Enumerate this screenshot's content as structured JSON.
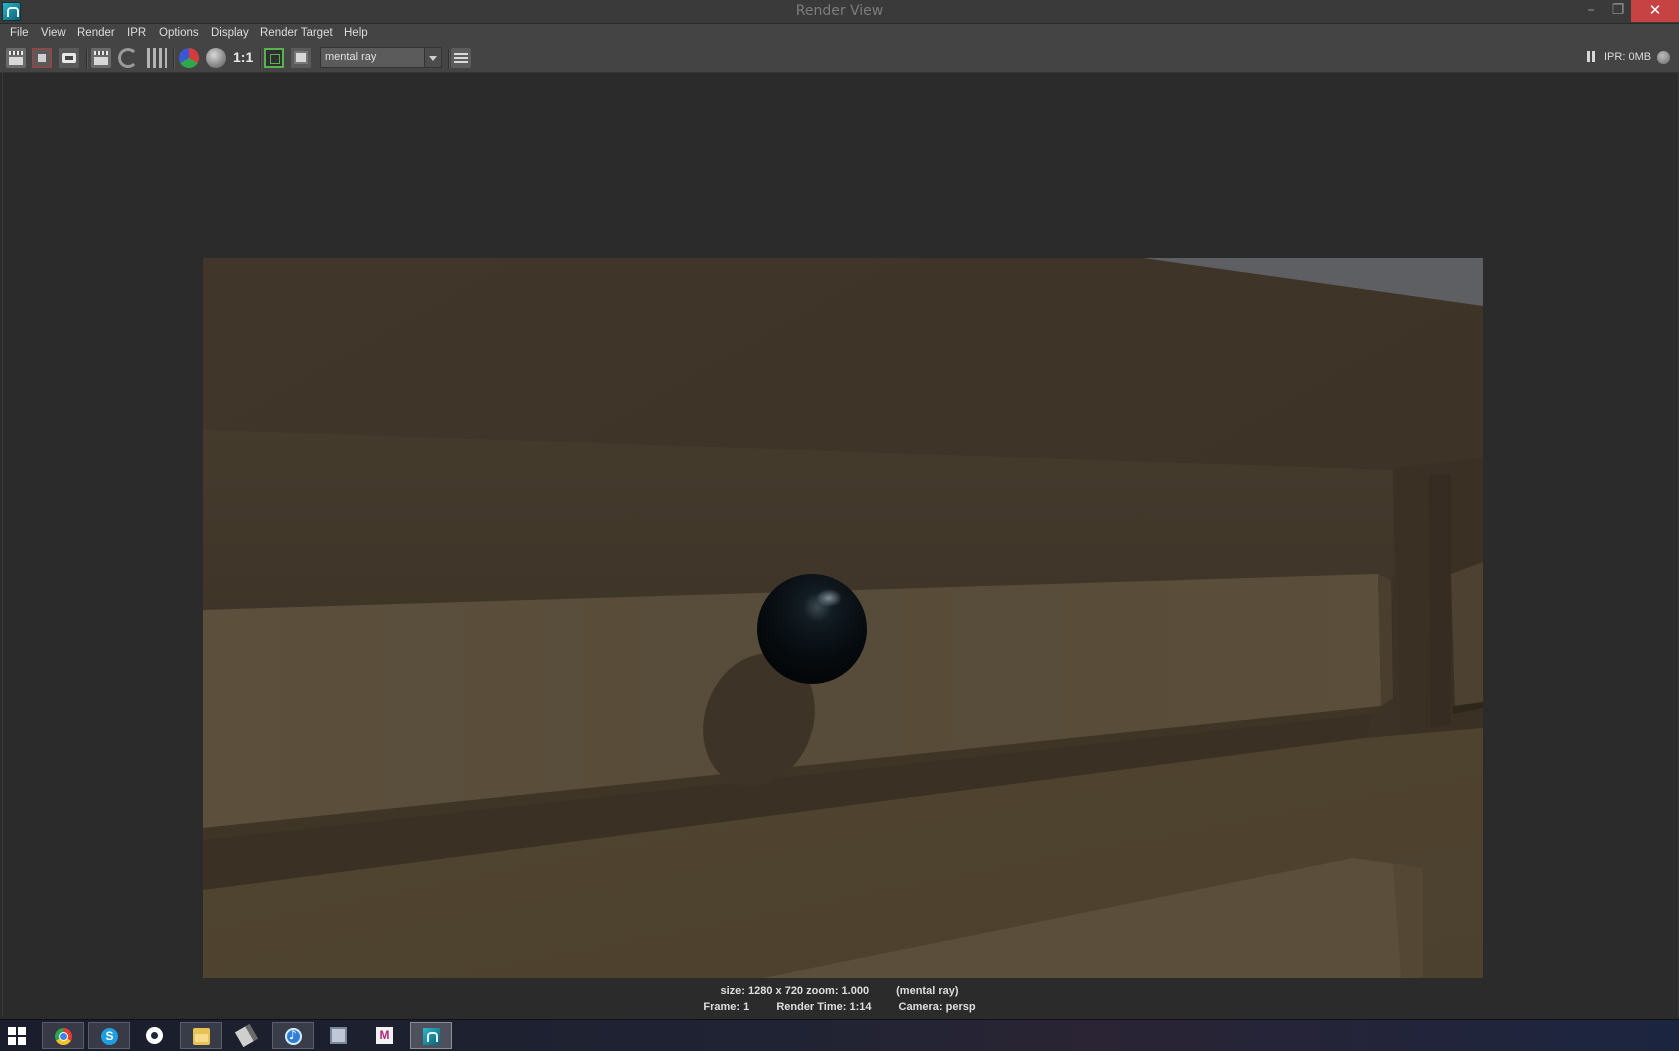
{
  "window": {
    "title": "Render View",
    "minimize_glyph": "–",
    "maximize_glyph": "❐",
    "close_glyph": "✕"
  },
  "menu": {
    "items": [
      "File",
      "View",
      "Render",
      "IPR",
      "Options",
      "Display",
      "Render Target",
      "Help"
    ]
  },
  "toolbar": {
    "ratio_label": "1:1",
    "renderer": "mental ray",
    "ipr_status": "IPR: 0MB"
  },
  "status": {
    "size": "size: 1280 x 720 zoom: 1.000",
    "renderer": "(mental ray)",
    "frame": "Frame: 1",
    "render_time": "Render Time: 1:14",
    "camera": "Camera: persp"
  },
  "taskbar": {
    "apps": [
      "start-icon",
      "chrome-icon",
      "skype-icon",
      "steam-icon",
      "file-explorer-icon",
      "pen-tool-icon",
      "itunes-icon",
      "monitor-icon",
      "mudbox-icon",
      "maya-icon"
    ],
    "skype_glyph": "S",
    "m_glyph": "M"
  },
  "colors": {
    "background": "#2b2b2b",
    "wall_upper": "#40362a",
    "wall_lower": "#574b39",
    "sphere": "#0a1014",
    "close_button": "#c74343"
  }
}
